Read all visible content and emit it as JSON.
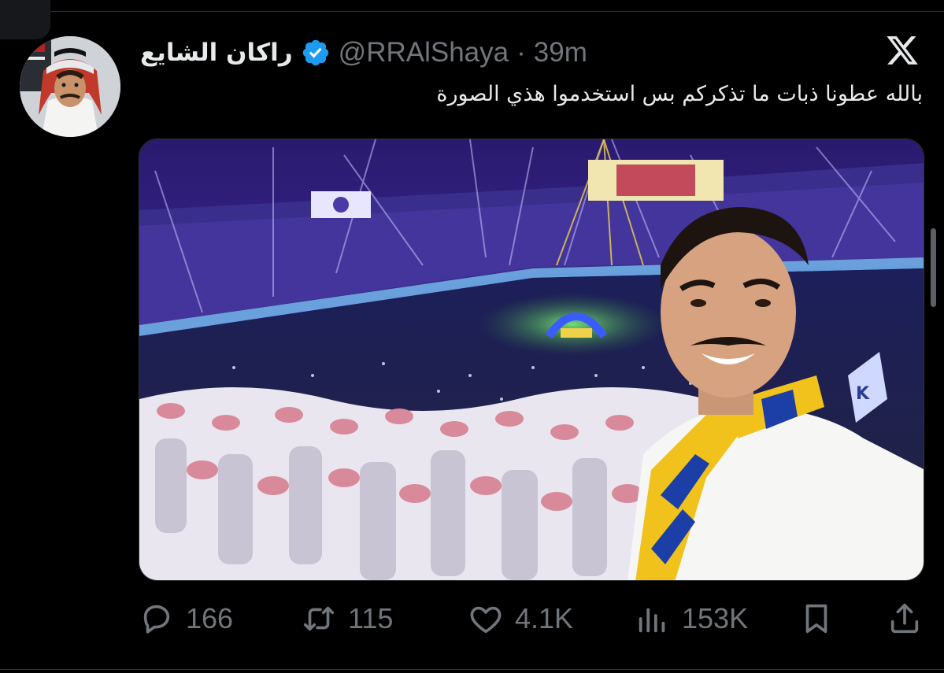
{
  "tweet": {
    "author": {
      "display_name": "راكان الشايع",
      "handle": "@RRAlShaya",
      "verified": true
    },
    "separator": "·",
    "time": "39m",
    "text": "بالله عطونا ذبات ما تذكركم بس استخدموا هذي الصورة",
    "media": {
      "type": "photo",
      "description_icon": "stadium-selfie-photo"
    }
  },
  "actions": {
    "reply": {
      "icon": "reply-icon",
      "count": "166"
    },
    "retweet": {
      "icon": "retweet-icon",
      "count": "115"
    },
    "like": {
      "icon": "heart-icon",
      "count": "4.1K"
    },
    "views": {
      "icon": "views-icon",
      "count": "153K"
    },
    "bookmark": {
      "icon": "bookmark-icon"
    },
    "share": {
      "icon": "share-icon"
    }
  },
  "branding": {
    "logo_icon": "x-logo-icon"
  },
  "colors": {
    "background": "#000000",
    "text": "#e7e9ea",
    "muted": "#71767b",
    "verified": "#1d9bf0",
    "divider": "#2f3336"
  }
}
